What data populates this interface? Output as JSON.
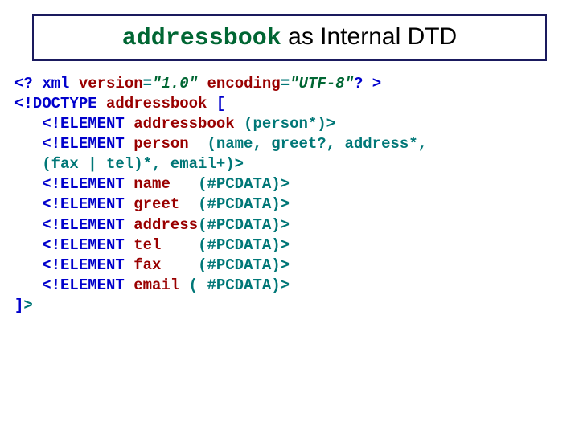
{
  "title": {
    "code": "addressbook",
    "rest": " as Internal DTD"
  },
  "lines": [
    [
      {
        "cls": "kw",
        "t": "<? xml "
      },
      {
        "cls": "nm",
        "t": "version"
      },
      {
        "cls": "op",
        "t": "="
      },
      {
        "cls": "str",
        "t": "\"1.0\""
      },
      {
        "cls": "kw",
        "t": " "
      },
      {
        "cls": "nm",
        "t": "encoding"
      },
      {
        "cls": "op",
        "t": "="
      },
      {
        "cls": "str",
        "t": "\"UTF-8\""
      },
      {
        "cls": "kw",
        "t": "? >"
      }
    ],
    [
      {
        "cls": "kw",
        "t": "<!DOCTYPE "
      },
      {
        "cls": "nm",
        "t": "addressbook"
      },
      {
        "cls": "kw",
        "t": " ["
      }
    ],
    [
      {
        "cls": "kw",
        "t": "   <!ELEMENT "
      },
      {
        "cls": "nm",
        "t": "addressbook "
      },
      {
        "cls": "op",
        "t": "(person*)>"
      }
    ],
    [
      {
        "cls": "kw",
        "t": "   <!ELEMENT "
      },
      {
        "cls": "nm",
        "t": "person  "
      },
      {
        "cls": "op",
        "t": "(name, greet?, address*,"
      }
    ],
    [
      {
        "cls": "op",
        "t": "   (fax | tel)*, email+)>"
      }
    ],
    [
      {
        "cls": "kw",
        "t": "   <!ELEMENT "
      },
      {
        "cls": "nm",
        "t": "name   "
      },
      {
        "cls": "op",
        "t": "(#PCDATA)>"
      }
    ],
    [
      {
        "cls": "kw",
        "t": "   <!ELEMENT "
      },
      {
        "cls": "nm",
        "t": "greet  "
      },
      {
        "cls": "op",
        "t": "(#PCDATA)>"
      }
    ],
    [
      {
        "cls": "kw",
        "t": "   <!ELEMENT "
      },
      {
        "cls": "nm",
        "t": "address"
      },
      {
        "cls": "op",
        "t": "(#PCDATA)>"
      }
    ],
    [
      {
        "cls": "kw",
        "t": "   <!ELEMENT "
      },
      {
        "cls": "nm",
        "t": "tel    "
      },
      {
        "cls": "op",
        "t": "(#PCDATA)>"
      }
    ],
    [
      {
        "cls": "kw",
        "t": "   <!ELEMENT "
      },
      {
        "cls": "nm",
        "t": "fax    "
      },
      {
        "cls": "op",
        "t": "(#PCDATA)>"
      }
    ],
    [
      {
        "cls": "kw",
        "t": "   <!ELEMENT "
      },
      {
        "cls": "nm",
        "t": "email "
      },
      {
        "cls": "op",
        "t": "( #PCDATA)>"
      }
    ],
    [
      {
        "cls": "kw",
        "t": "]"
      },
      {
        "cls": "op",
        "t": ">"
      }
    ]
  ]
}
